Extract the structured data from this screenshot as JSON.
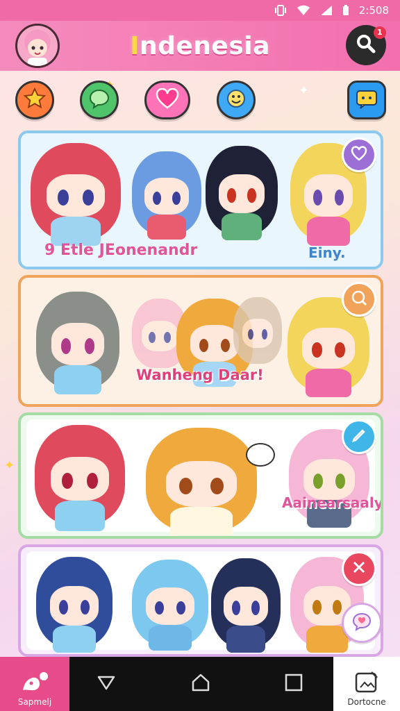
{
  "status_bar": {
    "time": "2:508"
  },
  "header": {
    "title_first": "I",
    "title_rest": "ndenesia",
    "notification_count": "1"
  },
  "categories": [
    {
      "name": "favorites",
      "icon": "star-icon"
    },
    {
      "name": "chat",
      "icon": "chat-bubble-icon"
    },
    {
      "name": "love",
      "icon": "heart-icon"
    },
    {
      "name": "emoji",
      "icon": "smile-icon"
    },
    {
      "name": "messages",
      "icon": "message-icon"
    }
  ],
  "packs": [
    {
      "label_left": "9 Etle JEonenandr",
      "label_right": "Einy.",
      "color": "#8cc9ee"
    },
    {
      "label": "Wanheng Daar!",
      "color": "#f2a35a"
    },
    {
      "label": "Aainearsaaly",
      "color": "#a5dca4"
    },
    {
      "label": "",
      "color": "#d8a6e4"
    }
  ],
  "nav": {
    "left_label": "Sapmelj",
    "right_label": "Dortocne"
  }
}
